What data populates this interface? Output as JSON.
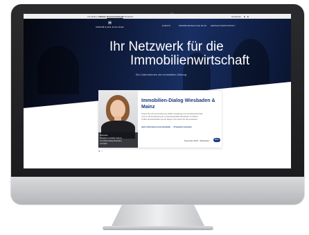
{
  "topbar": {
    "items": [
      "Immobilien Zeitung",
      "Events",
      "Netzwerkdialoge",
      "IZ Research"
    ],
    "right": "Newsletter"
  },
  "logo": {
    "mark": "H",
    "text": "IMMOBILIEN-DIALOGE"
  },
  "nav": [
    "EVENTS",
    "IMMOBILIENDIALOGE",
    "BLOG",
    "NEWSLETTER/KONTAKT"
  ],
  "hero": {
    "headline_line1": "Ihr Netzwerk für die",
    "headline_line2": "Immobilienwirtschaft",
    "subline": "Ein Unternehmen der Immobilien Zeitung"
  },
  "card": {
    "title": "Immobilien-Dialog Wiesbaden & Mainz",
    "text_lines": [
      "Freuen Sie sich auf Impulse aus Politik, Verwaltung und Immobilienwirtschaft",
      "rund um die Entwicklung der Landeshauptstädte Wiesbaden und Mainz.",
      "Treffen Sie Entscheider aus der Region und nutzen Sie den Austausch."
    ],
    "link": "Jetzt informieren und anmelden → Programm ansehen",
    "event": "November 2023 · Wiesbaden",
    "button": "Mehr",
    "photo_caption": [
      "Moderation",
      "Redaktion Immobilien Zeitung",
      "Immobilien-Dialog Wiesbaden",
      "und Mainz"
    ]
  },
  "colors": {
    "accent": "#1a3c7a",
    "hero_dark": "#0e1a3a"
  }
}
